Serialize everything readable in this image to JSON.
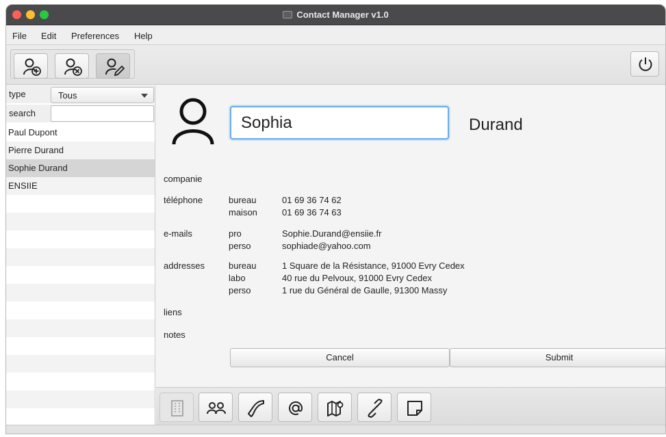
{
  "window": {
    "title": "Contact Manager v1.0"
  },
  "menu": {
    "items": [
      "File",
      "Edit",
      "Preferences",
      "Help"
    ]
  },
  "toolbar": {
    "buttons": [
      {
        "icon": "add-person-icon"
      },
      {
        "icon": "remove-person-icon"
      },
      {
        "icon": "edit-person-icon",
        "pressed": true
      }
    ],
    "power_icon": "power-icon"
  },
  "sidebar": {
    "type_label": "type",
    "type_value": "Tous",
    "search_label": "search",
    "search_value": "",
    "contacts": [
      "Paul Dupont",
      "Pierre Durand",
      "Sophie Durand",
      "ENSIIE"
    ],
    "selected_index": 2
  },
  "contact": {
    "first_name": "Sophia",
    "last_name": "Durand",
    "companie_label": "companie",
    "telephone_label": "téléphone",
    "phones": [
      {
        "type": "bureau",
        "value": "01 69 36 74 62"
      },
      {
        "type": "maison",
        "value": "01 69 36 74 63"
      }
    ],
    "emails_label": "e-mails",
    "emails": [
      {
        "type": "pro",
        "value": "Sophie.Durand@ensiie.fr"
      },
      {
        "type": "perso",
        "value": "sophiade@yahoo.com"
      }
    ],
    "addresses_label": "addresses",
    "addresses": [
      {
        "type": "bureau",
        "value": "1 Square de la Résistance, 91000 Evry Cedex"
      },
      {
        "type": "labo",
        "value": "40 rue du Pelvoux, 91000 Evry Cedex"
      },
      {
        "type": "perso",
        "value": "1 rue du Général de Gaulle, 91300 Massy"
      }
    ],
    "liens_label": "liens",
    "notes_label": "notes"
  },
  "actions": {
    "cancel_label": "Cancel",
    "submit_label": "Submit"
  },
  "bottom_toolbar": {
    "icons": [
      "building-icon",
      "group-icon",
      "phone-icon",
      "at-icon",
      "map-icon",
      "link-icon",
      "note-icon"
    ]
  },
  "colors": {
    "titlebar": "#4a4a4c",
    "focus": "#6aa9e6",
    "selected_row": "#d5d5d5"
  }
}
